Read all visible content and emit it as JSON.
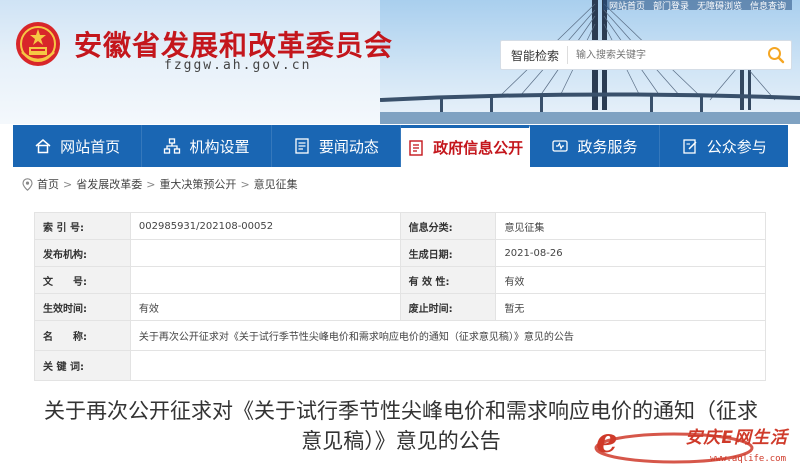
{
  "header": {
    "title": "安徽省发展和改革委员会",
    "domain": "fzggw.ah.gov.cn",
    "top_links": [
      "网站首页",
      "部门登录",
      "无障碍浏览",
      "信息查询"
    ],
    "search": {
      "label": "智能检索",
      "placeholder": "输入搜索关键字"
    }
  },
  "nav": {
    "items": [
      {
        "label": "网站首页",
        "icon": "home-icon"
      },
      {
        "label": "机构设置",
        "icon": "org-chart-icon"
      },
      {
        "label": "要闻动态",
        "icon": "news-icon"
      },
      {
        "label": "政府信息公开",
        "icon": "document-icon",
        "active": true
      },
      {
        "label": "政务服务",
        "icon": "service-icon"
      },
      {
        "label": "公众参与",
        "icon": "participation-icon"
      }
    ]
  },
  "breadcrumb": {
    "home": "首页",
    "items": [
      "省发展改革委",
      "重大决策预公开",
      "意见征集"
    ]
  },
  "info": {
    "index_label": "索 引 号:",
    "index_value": "002985931/202108-00052",
    "category_label": "信息分类:",
    "category_value": "意见征集",
    "publisher_label": "发布机构:",
    "publisher_value": "",
    "date_label": "生成日期:",
    "date_value": "2021-08-26",
    "docno_label": "文　　号:",
    "docno_value": "",
    "validity_label": "有 效 性:",
    "validity_value": "有效",
    "effective_label": "生效时间:",
    "effective_value": "有效",
    "repeal_label": "废止时间:",
    "repeal_value": "暂无",
    "name_label": "名　　称:",
    "name_value": "关于再次公开征求对《关于试行季节性尖峰电价和需求响应电价的通知（征求意见稿）》意见的公告",
    "keywords_label": "关 键 词:",
    "keywords_value": ""
  },
  "article": {
    "title": "关于再次公开征求对《关于试行季节性尖峰电价和需求响应电价的通知（征求意见稿）》意见的公告"
  },
  "watermark": {
    "text": "安庆E网生活",
    "url": "www.aqlife.com"
  },
  "colors": {
    "brand_red": "#c4161c",
    "nav_blue": "#1a66b3",
    "search_orange": "#f5a623"
  }
}
